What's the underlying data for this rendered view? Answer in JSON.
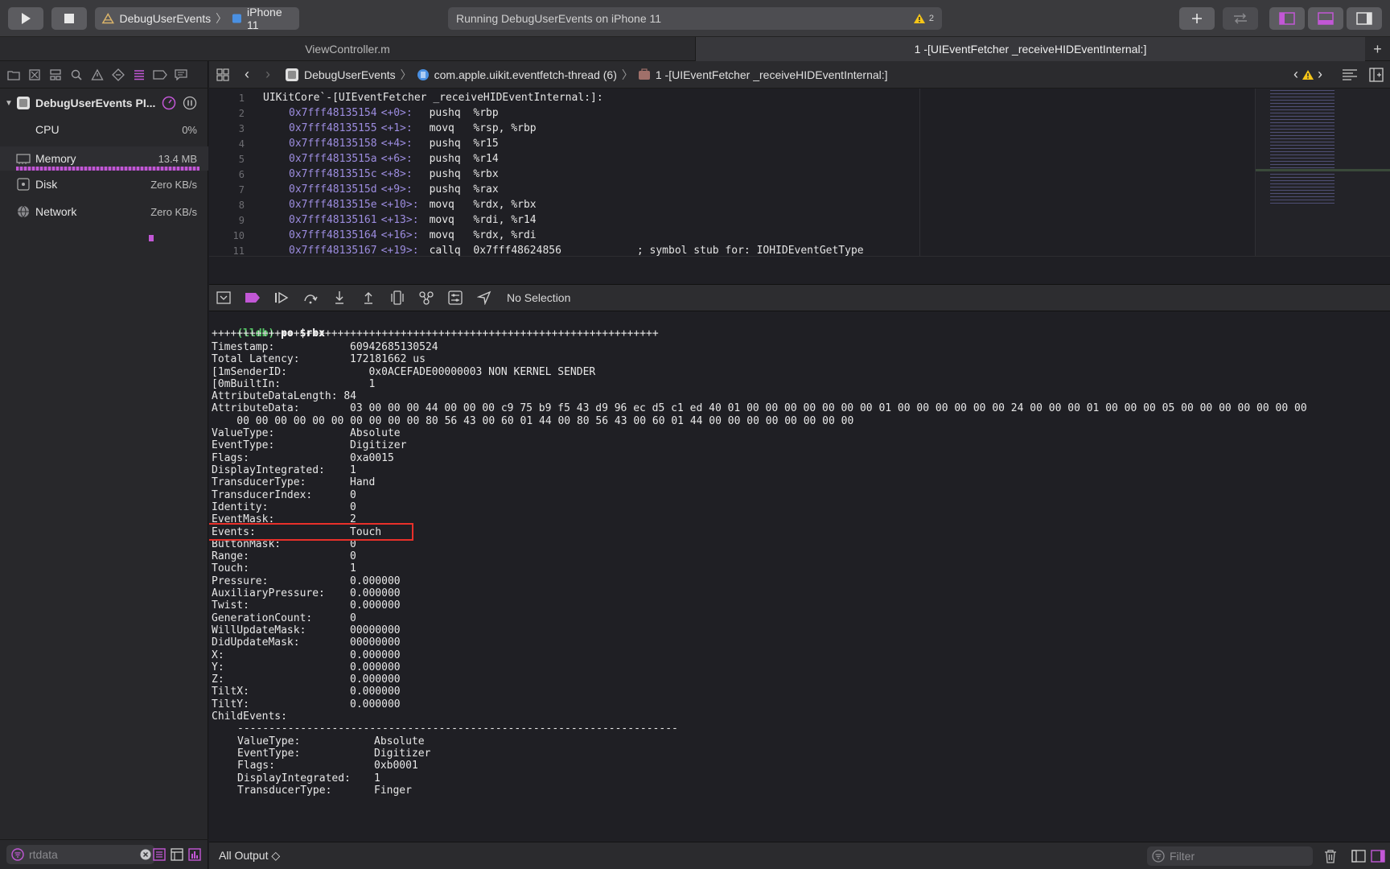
{
  "toolbar": {
    "scheme_name": "DebugUserEvents",
    "device_name": "iPhone 11",
    "status_text": "Running DebugUserEvents on iPhone 11",
    "warning_count": "2"
  },
  "tabs": [
    {
      "label": "ViewController.m",
      "active": false
    },
    {
      "label": "1 -[UIEventFetcher _receiveHIDEventInternal:]",
      "active": true
    }
  ],
  "navigator": {
    "process_name": "DebugUserEvents PI...",
    "gauges": [
      {
        "label": "CPU",
        "value": "0%"
      },
      {
        "label": "Memory",
        "value": "13.4 MB"
      },
      {
        "label": "Disk",
        "value": "Zero KB/s"
      },
      {
        "label": "Network",
        "value": "Zero KB/s"
      }
    ],
    "filter_placeholder": "rtdata"
  },
  "jumpbar": {
    "project": "DebugUserEvents",
    "thread": "com.apple.uikit.eventfetch-thread (6)",
    "frame": "1 -[UIEventFetcher _receiveHIDEventInternal:]"
  },
  "editor": {
    "header": "UIKitCore`-[UIEventFetcher _receiveHIDEventInternal:]:",
    "lines": [
      {
        "num": "1",
        "addr": "",
        "off": "",
        "ins": ""
      },
      {
        "num": "2",
        "addr": "0x7fff48135154",
        "off": "<+0>:",
        "ins": "pushq  %rbp"
      },
      {
        "num": "3",
        "addr": "0x7fff48135155",
        "off": "<+1>:",
        "ins": "movq   %rsp, %rbp"
      },
      {
        "num": "4",
        "addr": "0x7fff48135158",
        "off": "<+4>:",
        "ins": "pushq  %r15"
      },
      {
        "num": "5",
        "addr": "0x7fff4813515a",
        "off": "<+6>:",
        "ins": "pushq  %r14"
      },
      {
        "num": "6",
        "addr": "0x7fff4813515c",
        "off": "<+8>:",
        "ins": "pushq  %rbx"
      },
      {
        "num": "7",
        "addr": "0x7fff4813515d",
        "off": "<+9>:",
        "ins": "pushq  %rax"
      },
      {
        "num": "8",
        "addr": "0x7fff4813515e",
        "off": "<+10>:",
        "ins": "movq   %rdx, %rbx"
      },
      {
        "num": "9",
        "addr": "0x7fff48135161",
        "off": "<+13>:",
        "ins": "movq   %rdi, %r14"
      },
      {
        "num": "10",
        "addr": "0x7fff48135164",
        "off": "<+16>:",
        "ins": "movq   %rdx, %rdi"
      },
      {
        "num": "11",
        "addr": "0x7fff48135167",
        "off": "<+19>:",
        "ins": "callq  0x7fff48624856            ; symbol stub for: IOHIDEventGetType"
      }
    ]
  },
  "debugbar": {
    "selection_label": "No Selection"
  },
  "console": {
    "prompt": "(lldb)",
    "command": "po $rbx",
    "separator": "+++++++++++++++++++++++++++++++++++++++++++++++++++++++++++++++++++++++",
    "fields": [
      {
        "key": "Timestamp:",
        "value": "60942685130524"
      },
      {
        "key": "Total Latency:",
        "value": "172181662 us"
      },
      {
        "key": "[1mSenderID:",
        "value": "   0x0ACEFADE00000003 NON KERNEL SENDER"
      },
      {
        "key": "[0mBuiltIn:",
        "value": "   1"
      },
      {
        "key": "AttributeDataLength: 84",
        "value": ""
      },
      {
        "key": "AttributeData:",
        "value": "03 00 00 00 44 00 00 00 c9 75 b9 f5 43 d9 96 ec d5 c1 ed 40 01 00 00 00 00 00 00 00 01 00 00 00 00 00 00 24 00 00 00 01 00 00 00 05 00 00 00 00 00 00 00"
      },
      {
        "key": "",
        "value": "    00 00 00 00 00 00 00 00 00 00 80 56 43 00 60 01 44 00 80 56 43 00 60 01 44 00 00 00 00 00 00 00 00",
        "wrap": true
      },
      {
        "key": "ValueType:",
        "value": "Absolute"
      },
      {
        "key": "EventType:",
        "value": "Digitizer"
      },
      {
        "key": "Flags:",
        "value": "0xa0015"
      },
      {
        "key": "DisplayIntegrated:",
        "value": "1"
      },
      {
        "key": "TransducerType:",
        "value": "Hand"
      },
      {
        "key": "TransducerIndex:",
        "value": "0"
      },
      {
        "key": "Identity:",
        "value": "0"
      },
      {
        "key": "EventMask:",
        "value": "2"
      },
      {
        "key": "Events:",
        "value": "Touch"
      },
      {
        "key": "ButtonMask:",
        "value": "0"
      },
      {
        "key": "Range:",
        "value": "0"
      },
      {
        "key": "Touch:",
        "value": "1"
      },
      {
        "key": "Pressure:",
        "value": "0.000000"
      },
      {
        "key": "AuxiliaryPressure:",
        "value": "0.000000"
      },
      {
        "key": "Twist:",
        "value": "0.000000"
      },
      {
        "key": "GenerationCount:",
        "value": "0"
      },
      {
        "key": "WillUpdateMask:",
        "value": "00000000"
      },
      {
        "key": "DidUpdateMask:",
        "value": "00000000"
      },
      {
        "key": "X:",
        "value": "0.000000"
      },
      {
        "key": "Y:",
        "value": "0.000000"
      },
      {
        "key": "Z:",
        "value": "0.000000"
      },
      {
        "key": "TiltX:",
        "value": "0.000000"
      },
      {
        "key": "TiltY:",
        "value": "0.000000"
      },
      {
        "key": "ChildEvents:",
        "value": ""
      }
    ],
    "child_separator": "----------------------------------------------------------------------",
    "child_fields": [
      {
        "key": "ValueType:",
        "value": "Absolute"
      },
      {
        "key": "EventType:",
        "value": "Digitizer"
      },
      {
        "key": "Flags:",
        "value": "0xb0001"
      },
      {
        "key": "DisplayIntegrated:",
        "value": "1"
      },
      {
        "key": "TransducerType:",
        "value": "Finger"
      }
    ]
  },
  "bottombar": {
    "output_selector": "All Output ◇",
    "filter_placeholder": "Filter"
  },
  "colors": {
    "accent_pink": "#c257d6",
    "prompt_green": "#55c966",
    "address_purple": "#9d8de0",
    "highlight_red": "#e8302a"
  }
}
